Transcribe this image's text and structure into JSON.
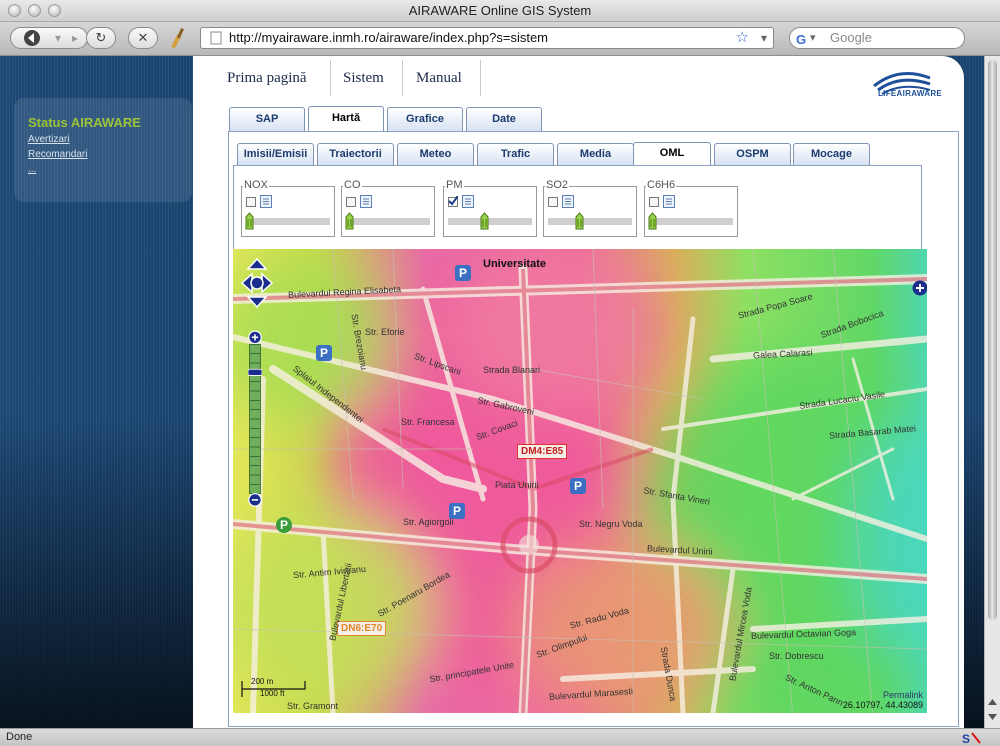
{
  "window": {
    "title": "AIRAWARE Online GIS System"
  },
  "browser": {
    "back_icon": "back-arrow-icon",
    "forward_icon": "forward-arrow-icon",
    "url": "http://myairaware.inmh.ro/airaware/index.php?s=sistem",
    "search_placeholder": "Google",
    "status": "Done"
  },
  "sidebar": {
    "title": "Status AIRAWARE",
    "links": [
      "Avertizari",
      "Recomandari",
      "..."
    ]
  },
  "topnav": {
    "items": [
      "Prima pagină",
      "Sistem",
      "Manual"
    ]
  },
  "logo": {
    "text": "LIFEAIRAWARE"
  },
  "main_tabs": {
    "items": [
      "SAP",
      "Hartă",
      "Grafice",
      "Date"
    ],
    "active": "Hartă"
  },
  "sub_tabs": {
    "items": [
      "Imisii/Emisii",
      "Traiectorii",
      "Meteo",
      "Trafic",
      "Media",
      "OML",
      "OSPM",
      "Mocage"
    ],
    "active": "OML"
  },
  "pollutants": [
    {
      "label": "NOX",
      "checked": false
    },
    {
      "label": "CO",
      "checked": false
    },
    {
      "label": "PM",
      "checked": true
    },
    {
      "label": "SO2",
      "checked": false
    },
    {
      "label": "C6H6",
      "checked": false
    }
  ],
  "map": {
    "place_title": "Universitate",
    "streets": [
      "Bulevardul Regina Elisabeta",
      "Str. Eforie",
      "Str. Brezoianu",
      "Splaiul Independentei",
      "Str. Francesa",
      "Str. Lipscani",
      "Strada Blanari",
      "Str. Gabroveni",
      "Str. Covaci",
      "Piata Unirii",
      "Str. Agiorgoli",
      "Str. Negru Voda",
      "Bulevardul Unirii",
      "Str. Sfanta Vineri",
      "Galea Calarasi",
      "Strada Lucaciu Vasile",
      "Strada Basarab Matei",
      "Str. Radu Voda",
      "Bulevardul Octavian Goga",
      "Str. Dobrescu",
      "Str. Anton Pann",
      "Str. Gramont",
      "Bulevardul Libertatii",
      "Str. Antim Ivireanu",
      "Str. Poenaru Bordea",
      "Bulevardul Marasesti",
      "Strada Dunca",
      "Bulevardul Mircea Voda",
      "Strada Popa Soare",
      "Strada Bobocica",
      "Str. Olimpului",
      "Str. principatele Unite"
    ],
    "sign_dm4": "DM4:E85",
    "sign_dn6": "DN6:E70",
    "scale_metric": "200 m",
    "scale_imperial": "1000 ft",
    "permalink": "Permalink",
    "coordinates": "26.10797, 44.43089"
  }
}
